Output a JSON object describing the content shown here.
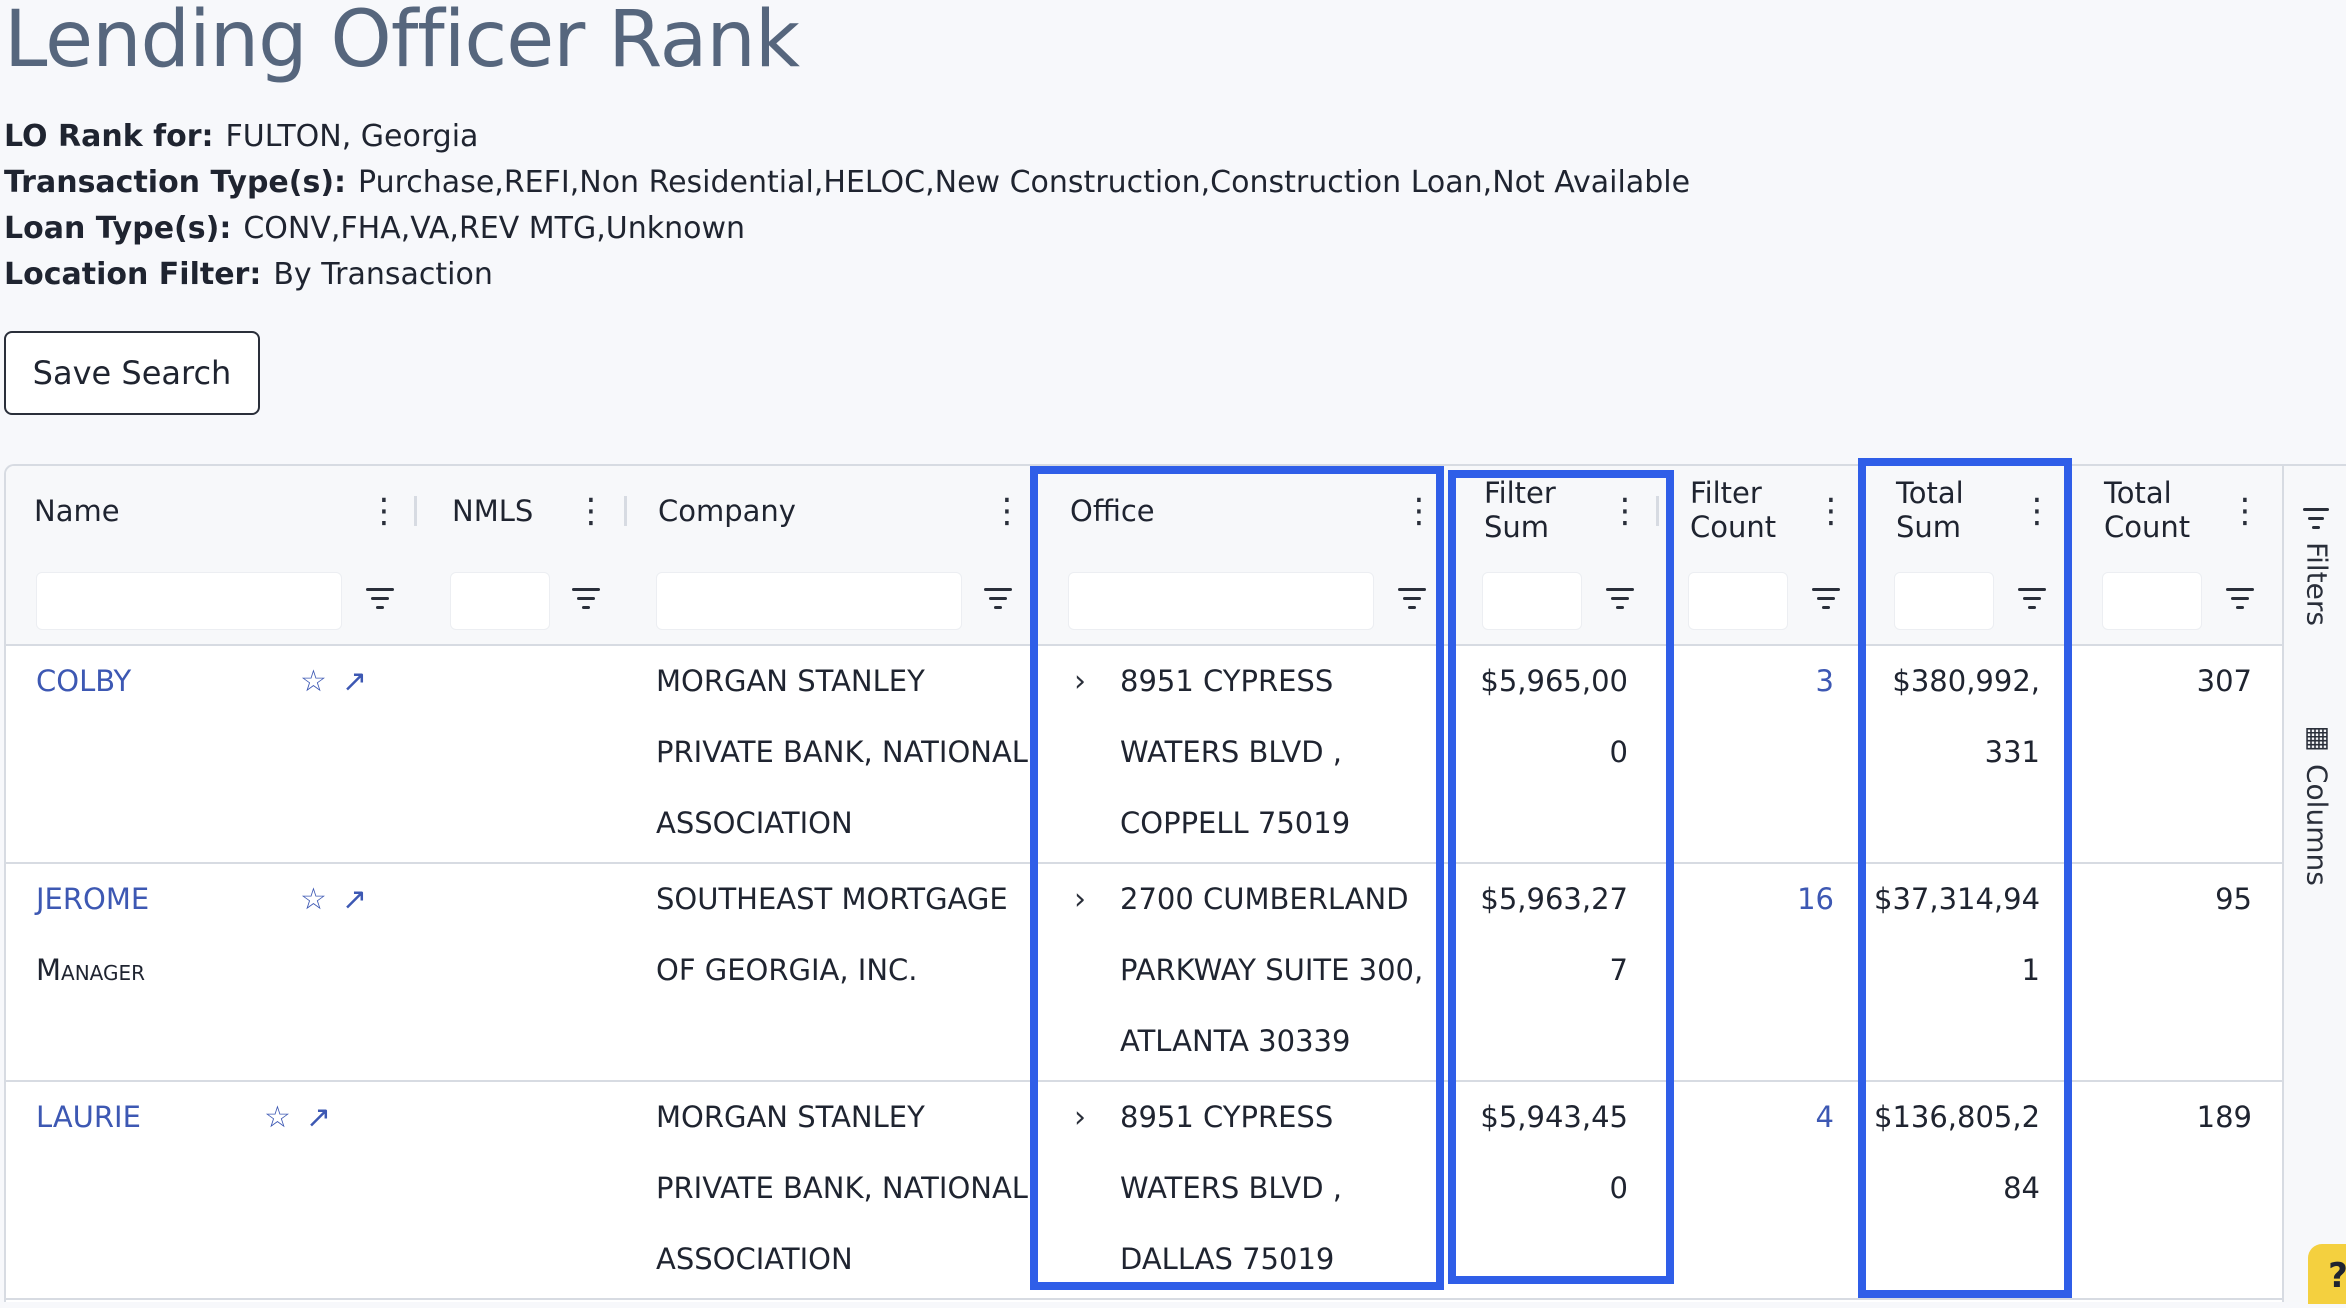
{
  "page": {
    "title": "Lending Officer Rank",
    "meta": [
      {
        "label": "LO Rank for:",
        "value": "FULTON, Georgia"
      },
      {
        "label": "Transaction Type(s):",
        "value": "Purchase,REFI,Non Residential,HELOC,New Construction,Construction Loan,Not Available"
      },
      {
        "label": "Loan Type(s):",
        "value": "CONV,FHA,VA,REV MTG,Unknown"
      },
      {
        "label": "Location Filter:",
        "value": "By Transaction"
      }
    ],
    "save_button": "Save Search"
  },
  "columns": {
    "name": "Name",
    "nmls": "NMLS",
    "company": "Company",
    "office": "Office",
    "filter_sum": [
      "Filter",
      "Sum"
    ],
    "filter_count": [
      "Filter",
      "Count"
    ],
    "total_sum": [
      "Total",
      "Sum"
    ],
    "total_count": [
      "Total",
      "Count"
    ]
  },
  "rows": [
    {
      "name": "COLBY",
      "subtitle": "",
      "company": [
        "MORGAN STANLEY",
        "PRIVATE BANK, NATIONAL",
        "ASSOCIATION"
      ],
      "office": [
        "8951 CYPRESS",
        "WATERS BLVD ,",
        "COPPELL 75019"
      ],
      "filter_sum": [
        "$5,965,00",
        "0"
      ],
      "filter_count": "3",
      "total_sum": [
        "$380,992,",
        "331"
      ],
      "total_count": "307"
    },
    {
      "name": "JEROME",
      "subtitle": "Manager",
      "company": [
        "SOUTHEAST MORTGAGE",
        "OF GEORGIA, INC.",
        ""
      ],
      "office": [
        "2700 CUMBERLAND",
        "PARKWAY SUITE 300,",
        "ATLANTA 30339"
      ],
      "filter_sum": [
        "$5,963,27",
        "7"
      ],
      "filter_count": "16",
      "total_sum": [
        "$37,314,94",
        "1"
      ],
      "total_count": "95"
    },
    {
      "name": "LAURIE",
      "subtitle": "",
      "company": [
        "MORGAN STANLEY",
        "PRIVATE BANK, NATIONAL",
        "ASSOCIATION"
      ],
      "office": [
        "8951 CYPRESS",
        "WATERS BLVD ,",
        "DALLAS 75019"
      ],
      "filter_sum": [
        "$5,943,45",
        "0"
      ],
      "filter_count": "4",
      "total_sum": [
        "$136,805,2",
        "84"
      ],
      "total_count": "189"
    }
  ],
  "sidebar": {
    "filters": "Filters",
    "columns": "Columns"
  },
  "help": "?",
  "colors": {
    "title": "#56667d",
    "link": "#3d58b3",
    "highlight": "#2f5ee8",
    "help": "#f4d03f"
  },
  "icons": [
    "star-icon",
    "external-link-icon",
    "chevron-right-icon",
    "kebab-menu-icon",
    "filter-icon",
    "columns-icon"
  ]
}
